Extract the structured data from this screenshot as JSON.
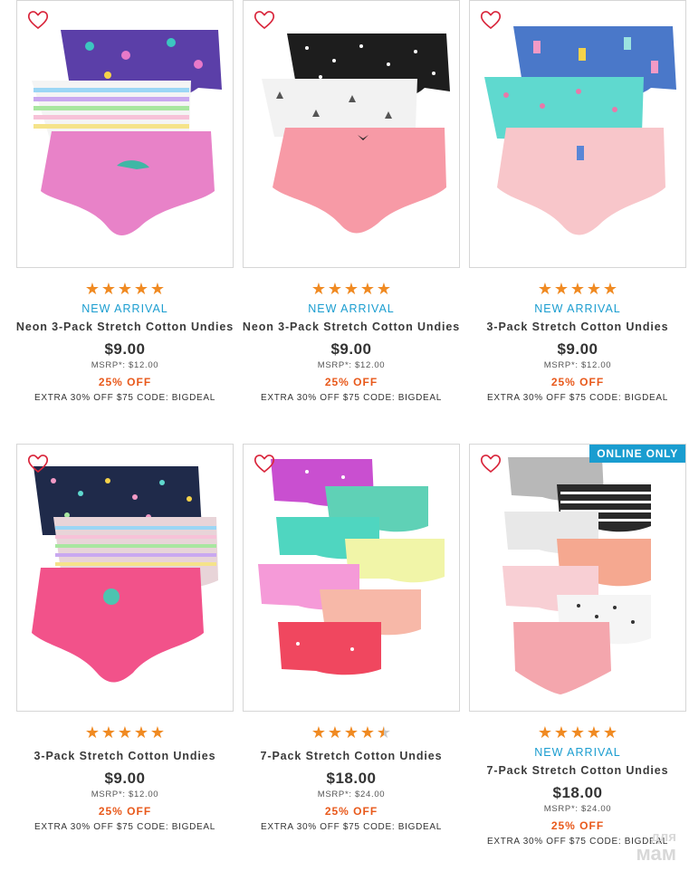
{
  "products": [
    {
      "name": "Neon 3-Pack Stretch Cotton Undies",
      "rating": 5,
      "new_arrival": "NEW ARRIVAL",
      "price": "$9.00",
      "msrp": "MSRP*: $12.00",
      "discount": "25% OFF",
      "promo": "EXTRA 30% OFF $75 CODE: BIGDEAL"
    },
    {
      "name": "Neon 3-Pack Stretch Cotton Undies",
      "rating": 5,
      "new_arrival": "NEW ARRIVAL",
      "price": "$9.00",
      "msrp": "MSRP*: $12.00",
      "discount": "25% OFF",
      "promo": "EXTRA 30% OFF $75 CODE: BIGDEAL"
    },
    {
      "name": "3-Pack Stretch Cotton Undies",
      "rating": 5,
      "new_arrival": "NEW ARRIVAL",
      "price": "$9.00",
      "msrp": "MSRP*: $12.00",
      "discount": "25% OFF",
      "promo": "EXTRA 30% OFF $75 CODE: BIGDEAL"
    },
    {
      "name": "3-Pack Stretch Cotton Undies",
      "rating": 5,
      "price": "$9.00",
      "msrp": "MSRP*: $12.00",
      "discount": "25% OFF",
      "promo": "EXTRA 30% OFF $75 CODE: BIGDEAL"
    },
    {
      "name": "7-Pack Stretch Cotton Undies",
      "rating": 4.5,
      "price": "$18.00",
      "msrp": "MSRP*: $24.00",
      "discount": "25% OFF",
      "promo": "EXTRA 30% OFF $75 CODE: BIGDEAL"
    },
    {
      "name": "7-Pack Stretch Cotton Undies",
      "rating": 5,
      "new_arrival": "NEW ARRIVAL",
      "badge": "ONLINE ONLY",
      "price": "$18.00",
      "msrp": "MSRP*: $24.00",
      "discount": "25% OFF",
      "promo": "EXTRA 30% OFF $75 CODE: BIGDEAL"
    }
  ],
  "icons": {
    "favorite": "heart-outline-icon",
    "rating": "star-icon"
  },
  "colors": {
    "star": "#f08a22",
    "new_arrival": "#1a9dd0",
    "discount": "#e8591b",
    "badge_bg": "#1a9dd0",
    "heart": "#d9263c"
  },
  "watermark": {
    "line1": "для",
    "line2": "мам"
  }
}
